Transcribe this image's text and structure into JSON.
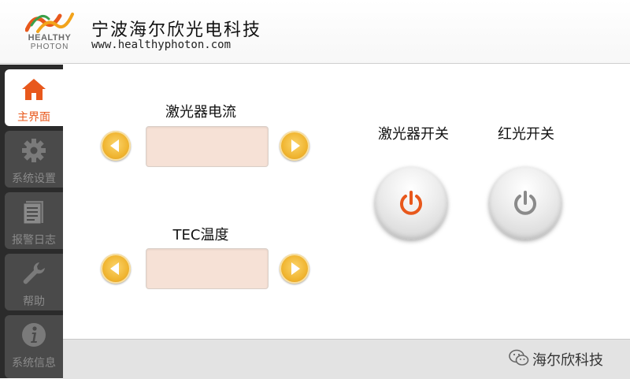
{
  "header": {
    "logo_line1": "HEALTHY",
    "logo_line2": "PHOTON",
    "company_name": "宁波海尔欣光电科技",
    "url": "www.healthyphoton.com"
  },
  "sidebar": {
    "items": [
      {
        "label": "主界面",
        "icon": "home-icon",
        "active": true
      },
      {
        "label": "系统设置",
        "icon": "gear-icon",
        "active": false
      },
      {
        "label": "报警日志",
        "icon": "log-icon",
        "active": false
      },
      {
        "label": "帮助",
        "icon": "wrench-icon",
        "active": false
      },
      {
        "label": "系统信息",
        "icon": "info-icon",
        "active": false
      }
    ]
  },
  "main": {
    "laser_current": {
      "label": "激光器电流",
      "value": ""
    },
    "tec_temperature": {
      "label": "TEC温度",
      "value": ""
    },
    "laser_switch": {
      "label": "激光器开关"
    },
    "red_light_switch": {
      "label": "红光开关"
    }
  },
  "footer": {
    "wechat_label": "海尔欣科技"
  },
  "colors": {
    "accent": "#e8581c",
    "sidebar_bg": "#2b2b2b",
    "arrow_gold": "#f0b531",
    "value_box_bg": "#f6e1d6",
    "power_off_gray": "#8a8a8a"
  }
}
